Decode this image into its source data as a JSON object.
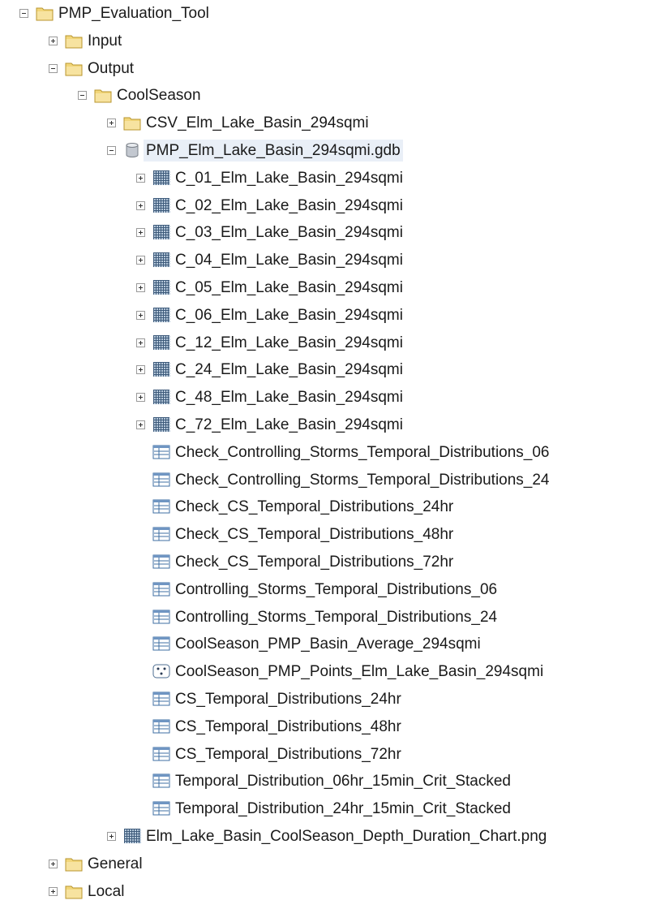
{
  "tree": [
    {
      "label": "PMP_Evaluation_Tool",
      "icon": "folder-icon",
      "expander": "minus",
      "depth": 0
    },
    {
      "label": "Input",
      "icon": "folder-icon",
      "expander": "plus",
      "depth": 1
    },
    {
      "label": "Output",
      "icon": "folder-icon",
      "expander": "minus",
      "depth": 1
    },
    {
      "label": "CoolSeason",
      "icon": "folder-icon",
      "expander": "minus",
      "depth": 2
    },
    {
      "label": "CSV_Elm_Lake_Basin_294sqmi",
      "icon": "folder-icon",
      "expander": "plus",
      "depth": 3
    },
    {
      "label": "PMP_Elm_Lake_Basin_294sqmi.gdb",
      "icon": "geodatabase-icon",
      "expander": "minus",
      "depth": 3,
      "selected": true
    },
    {
      "label": "C_01_Elm_Lake_Basin_294sqmi",
      "icon": "raster-icon",
      "expander": "plus",
      "depth": 4
    },
    {
      "label": "C_02_Elm_Lake_Basin_294sqmi",
      "icon": "raster-icon",
      "expander": "plus",
      "depth": 4
    },
    {
      "label": "C_03_Elm_Lake_Basin_294sqmi",
      "icon": "raster-icon",
      "expander": "plus",
      "depth": 4
    },
    {
      "label": "C_04_Elm_Lake_Basin_294sqmi",
      "icon": "raster-icon",
      "expander": "plus",
      "depth": 4
    },
    {
      "label": "C_05_Elm_Lake_Basin_294sqmi",
      "icon": "raster-icon",
      "expander": "plus",
      "depth": 4
    },
    {
      "label": "C_06_Elm_Lake_Basin_294sqmi",
      "icon": "raster-icon",
      "expander": "plus",
      "depth": 4
    },
    {
      "label": "C_12_Elm_Lake_Basin_294sqmi",
      "icon": "raster-icon",
      "expander": "plus",
      "depth": 4
    },
    {
      "label": "C_24_Elm_Lake_Basin_294sqmi",
      "icon": "raster-icon",
      "expander": "plus",
      "depth": 4
    },
    {
      "label": "C_48_Elm_Lake_Basin_294sqmi",
      "icon": "raster-icon",
      "expander": "plus",
      "depth": 4
    },
    {
      "label": "C_72_Elm_Lake_Basin_294sqmi",
      "icon": "raster-icon",
      "expander": "plus",
      "depth": 4
    },
    {
      "label": "Check_Controlling_Storms_Temporal_Distributions_06",
      "icon": "table-icon",
      "expander": "none",
      "depth": 4
    },
    {
      "label": "Check_Controlling_Storms_Temporal_Distributions_24",
      "icon": "table-icon",
      "expander": "none",
      "depth": 4
    },
    {
      "label": "Check_CS_Temporal_Distributions_24hr",
      "icon": "table-icon",
      "expander": "none",
      "depth": 4
    },
    {
      "label": "Check_CS_Temporal_Distributions_48hr",
      "icon": "table-icon",
      "expander": "none",
      "depth": 4
    },
    {
      "label": "Check_CS_Temporal_Distributions_72hr",
      "icon": "table-icon",
      "expander": "none",
      "depth": 4
    },
    {
      "label": "Controlling_Storms_Temporal_Distributions_06",
      "icon": "table-icon",
      "expander": "none",
      "depth": 4
    },
    {
      "label": "Controlling_Storms_Temporal_Distributions_24",
      "icon": "table-icon",
      "expander": "none",
      "depth": 4
    },
    {
      "label": "CoolSeason_PMP_Basin_Average_294sqmi",
      "icon": "table-icon",
      "expander": "none",
      "depth": 4
    },
    {
      "label": "CoolSeason_PMP_Points_Elm_Lake_Basin_294sqmi",
      "icon": "point-feature-icon",
      "expander": "none",
      "depth": 4
    },
    {
      "label": "CS_Temporal_Distributions_24hr",
      "icon": "table-icon",
      "expander": "none",
      "depth": 4
    },
    {
      "label": "CS_Temporal_Distributions_48hr",
      "icon": "table-icon",
      "expander": "none",
      "depth": 4
    },
    {
      "label": "CS_Temporal_Distributions_72hr",
      "icon": "table-icon",
      "expander": "none",
      "depth": 4
    },
    {
      "label": "Temporal_Distribution_06hr_15min_Crit_Stacked",
      "icon": "table-icon",
      "expander": "none",
      "depth": 4
    },
    {
      "label": "Temporal_Distribution_24hr_15min_Crit_Stacked",
      "icon": "table-icon",
      "expander": "none",
      "depth": 4
    },
    {
      "label": "Elm_Lake_Basin_CoolSeason_Depth_Duration_Chart.png",
      "icon": "raster-icon",
      "expander": "plus",
      "depth": 3
    },
    {
      "label": "General",
      "icon": "folder-icon",
      "expander": "plus",
      "depth": 1
    },
    {
      "label": "Local",
      "icon": "folder-icon",
      "expander": "plus",
      "depth": 1
    }
  ],
  "colors": {
    "folder": "#f2d67a",
    "selection": "#e9eff7"
  }
}
